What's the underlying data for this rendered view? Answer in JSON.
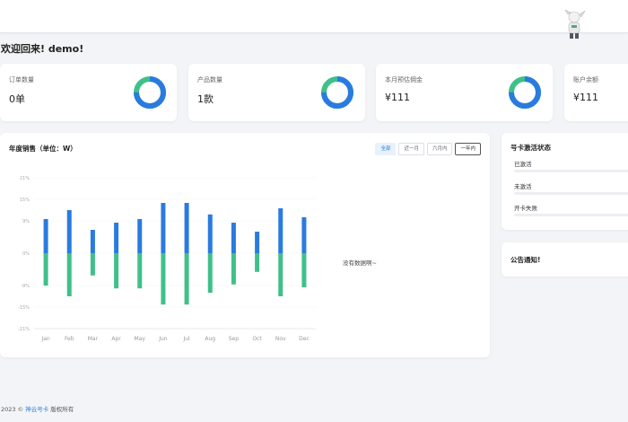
{
  "welcome": "欢迎回来! demo!",
  "stats": [
    {
      "label": "订单数量",
      "value": "0单",
      "percent": 75
    },
    {
      "label": "产品数量",
      "value": "1款",
      "percent": 75
    },
    {
      "label": "本月预估佣金",
      "value": "¥111",
      "percent": 75
    },
    {
      "label": "账户余额",
      "value": "¥111"
    }
  ],
  "colors": {
    "blue": "#2a7be0",
    "green": "#3fc08a",
    "track": "#e6e8ed"
  },
  "sales": {
    "title": "年度销售（单位：W）",
    "tabs": [
      "全部",
      "近一月",
      "六月内",
      "一年内"
    ],
    "active_tab": "全部",
    "no_data": "没有数据啊~"
  },
  "chart_data": {
    "type": "bar",
    "categories": [
      "Jan",
      "Feb",
      "Mar",
      "Apr",
      "May",
      "Jun",
      "Jul",
      "Aug",
      "Sep",
      "Oct",
      "Nov",
      "Dec"
    ],
    "y_ticks": [
      "21%",
      "15%",
      "9%",
      "0%",
      "-9%",
      "-15%",
      "-21%"
    ],
    "series": [
      {
        "color": "#2a7be0",
        "values": [
          9.5,
          12,
          6.5,
          8.5,
          9.5,
          14,
          14,
          10.8,
          8.5,
          6,
          12.5,
          10
        ]
      },
      {
        "color": "#3fc08a",
        "values": [
          -9,
          -12,
          -6.2,
          -9.8,
          -9.8,
          -14.3,
          -14.3,
          -11,
          -8.7,
          -5.2,
          -12,
          -9.5
        ]
      }
    ],
    "ylim": [
      -21,
      21
    ]
  },
  "activation": {
    "title": "号卡激活状态",
    "items": [
      "已激活",
      "未激活",
      "开卡失败"
    ]
  },
  "notice": {
    "title": "公告通知!"
  },
  "footer": {
    "prefix": "2023 ©",
    "link": "神云号卡",
    "suffix": "版权所有"
  }
}
